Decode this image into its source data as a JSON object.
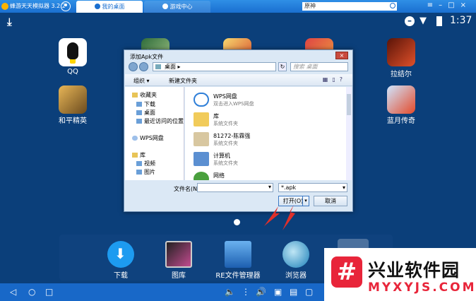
{
  "emulator": {
    "title": "蜂游天天模拟器 3.2.2",
    "tabs": [
      {
        "label": "我的桌面",
        "active": true
      },
      {
        "label": "游戏中心",
        "active": false
      }
    ],
    "search_value": "原神",
    "accent": "#1a6fd0"
  },
  "status": {
    "time": "1:37"
  },
  "desktop_apps": [
    {
      "label": "QQ"
    },
    {
      "label": "拉结尔"
    },
    {
      "label": "和平精英"
    },
    {
      "label": "蓝月传奇"
    }
  ],
  "dialog": {
    "title": "添加Apk文件",
    "address": "桌面",
    "search_placeholder": "搜索 桌面",
    "toolbar": {
      "organize": "组织 ▾",
      "new_folder": "新建文件夹"
    },
    "nav_items": [
      {
        "label": "收藏夹"
      },
      {
        "label": "下载"
      },
      {
        "label": "桌面"
      },
      {
        "label": "最近访问的位置"
      },
      {
        "label": "WPS网盘"
      },
      {
        "label": "库"
      },
      {
        "label": "视频"
      },
      {
        "label": "图片"
      }
    ],
    "files": [
      {
        "name": "WPS网盘",
        "desc": "双击进入WPS网盘"
      },
      {
        "name": "库",
        "desc": "系统文件夹"
      },
      {
        "name": "81272-陈霖强",
        "desc": "系统文件夹"
      },
      {
        "name": "计算机",
        "desc": "系统文件夹"
      },
      {
        "name": "网络",
        "desc": ""
      }
    ],
    "filename_label": "文件名(N):",
    "filename_value": "",
    "filter_value": "*.apk",
    "open_label": "打开(O)",
    "cancel_label": "取消"
  },
  "dock": [
    {
      "label": "下载"
    },
    {
      "label": "图库"
    },
    {
      "label": "RE文件管理器"
    },
    {
      "label": "浏览器"
    }
  ],
  "watermark": {
    "title": "兴业软件园",
    "url": "MYXYJS.COM",
    "color": "#e8253a"
  }
}
